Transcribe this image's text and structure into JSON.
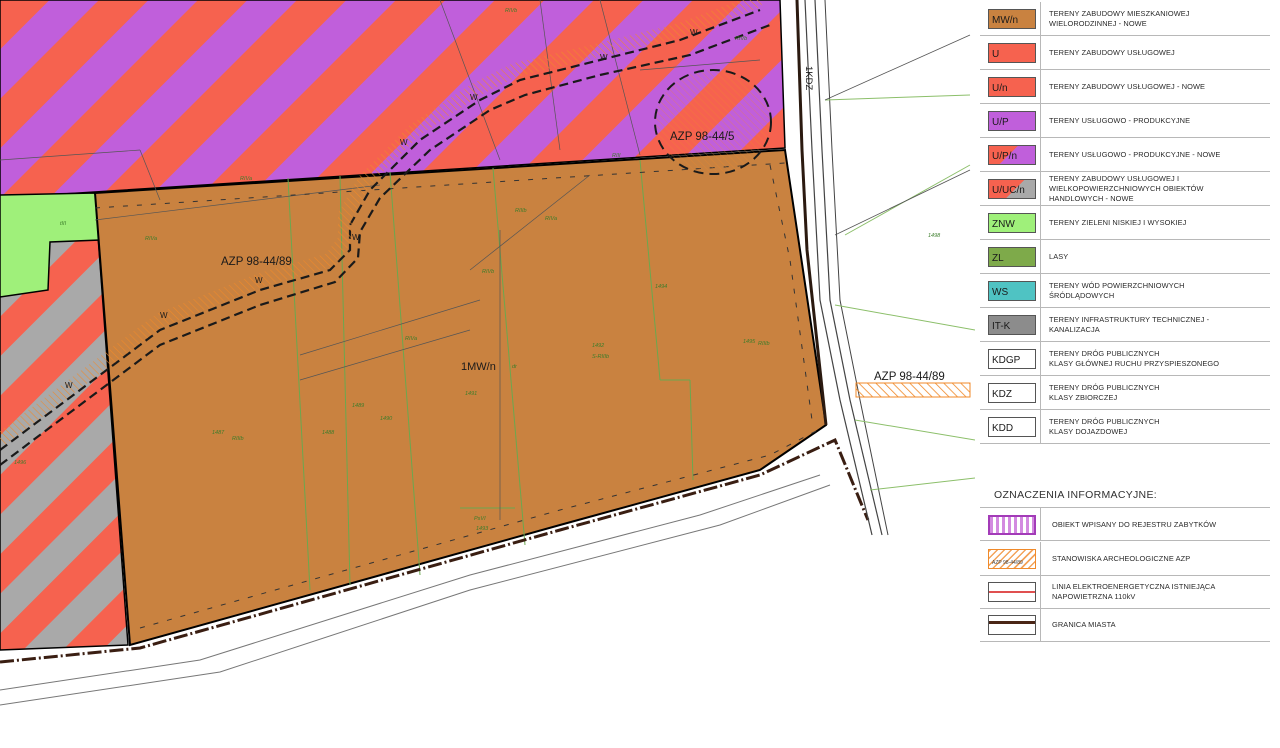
{
  "map": {
    "labels": {
      "azp_5": "AZP 98-44/5",
      "azp_89_main": "AZP 98-44/89",
      "azp_89_right": "AZP 98-44/89",
      "zone_1mwn": "1MW/n",
      "road_1kdz": "1KDZ",
      "mark_w": "W"
    },
    "small_labels": {
      "rivb_1": "RIVb",
      "rivb_2": "RIVb",
      "riva_1": "RIVa",
      "riva_2": "RIVa",
      "riva_3": "RIVa",
      "riva_4": "RIVa",
      "rivb_3": "RIVb",
      "riiib_1": "RIIIb",
      "riiib_2": "RIIIb",
      "riiib_3": "RIIIb",
      "riii_1": "RIII",
      "tiii": "tIII",
      "lot_1487": "1487",
      "lot_1488": "1488",
      "lot_1489": "1489",
      "lot_1490": "1490",
      "lot_1491": "1491",
      "lot_1492": "1492",
      "s_riiib": "S-RIIIb",
      "lot_1494": "1494",
      "lot_1495": "1495",
      "lot_1496": "1496",
      "lot_1498": "1498",
      "psvi": "PsVI",
      "lot_1493": "1493",
      "dr": "dr"
    }
  },
  "legend": {
    "rows": [
      {
        "code": "MW/n",
        "desc": [
          "TERENY ZABUDOWY MIESZKANIOWEJ",
          "WIELORODZINNEJ - NOWE"
        ],
        "color": "#c98240"
      },
      {
        "code": "U",
        "desc": [
          "TERENY ZABUDOWY USŁUGOWEJ"
        ],
        "color": "#f6624f"
      },
      {
        "code": "U/n",
        "desc": [
          "TERENY ZABUDOWY USŁUGOWEJ - NOWE"
        ],
        "color": "#f6624f"
      },
      {
        "code": "U/P",
        "desc": [
          "TERENY USŁUGOWO - PRODUKCYJNE"
        ],
        "color": "#c05fdb"
      },
      {
        "code": "U/P/n",
        "desc": [
          "TERENY USŁUGOWO - PRODUKCYJNE - NOWE"
        ],
        "color": "#c05fdb"
      },
      {
        "code": "U/UC/n",
        "desc": [
          "TERENY ZABUDOWY USŁUGOWEJ I",
          "WIELKOPOWIERZCHNIOWYCH OBIEKTÓW",
          "HANDLOWYCH - NOWE"
        ],
        "color": "#f6624f"
      },
      {
        "code": "ZNW",
        "desc": [
          "TERENY ZIELENI NISKIEJ I WYSOKIEJ"
        ],
        "color": "#9ff07a"
      },
      {
        "code": "ZL",
        "desc": [
          "LASY"
        ],
        "color": "#7eaa4a"
      },
      {
        "code": "WS",
        "desc": [
          "TERENY WÓD POWIERZCHNIOWYCH",
          "ŚRÓDLĄDOWYCH"
        ],
        "color": "#4fc3c3"
      },
      {
        "code": "IT-K",
        "desc": [
          "TERENY INFRASTRUKTURY TECHNICZNEJ -",
          "KANALIZACJA"
        ],
        "color": "#8c8c8c"
      },
      {
        "code": "KDGP",
        "desc": [
          "TERENY DRÓG PUBLICZNYCH",
          "KLASY GŁÓWNEJ RUCHU PRZYSPIESZONEGO"
        ],
        "color": "#ffffff"
      },
      {
        "code": "KDZ",
        "desc": [
          "TERENY DRÓG PUBLICZNYCH",
          "KLASY ZBIORCZEJ"
        ],
        "color": "#ffffff"
      },
      {
        "code": "KDD",
        "desc": [
          "TERENY DRÓG PUBLICZNYCH",
          "KLASY DOJAZDOWEJ"
        ],
        "color": "#ffffff"
      }
    ],
    "info_title": "OZNACZENIA INFORMACYJNE:",
    "info_rows": [
      {
        "desc": [
          "OBIEKT WPISANY DO REJESTRU ZABYTKÓW"
        ]
      },
      {
        "desc": [
          "STANOWISKA ARCHEOLOGICZNE AZP"
        ],
        "swatch_text": "AZP 98-44/89"
      },
      {
        "desc": [
          "LINIA ELEKTROENERGETYCZNA ISTNIEJĄCA",
          "NAPOWIETRZNA 110kV"
        ]
      },
      {
        "desc": [
          "GRANICA MIASTA"
        ]
      }
    ]
  }
}
